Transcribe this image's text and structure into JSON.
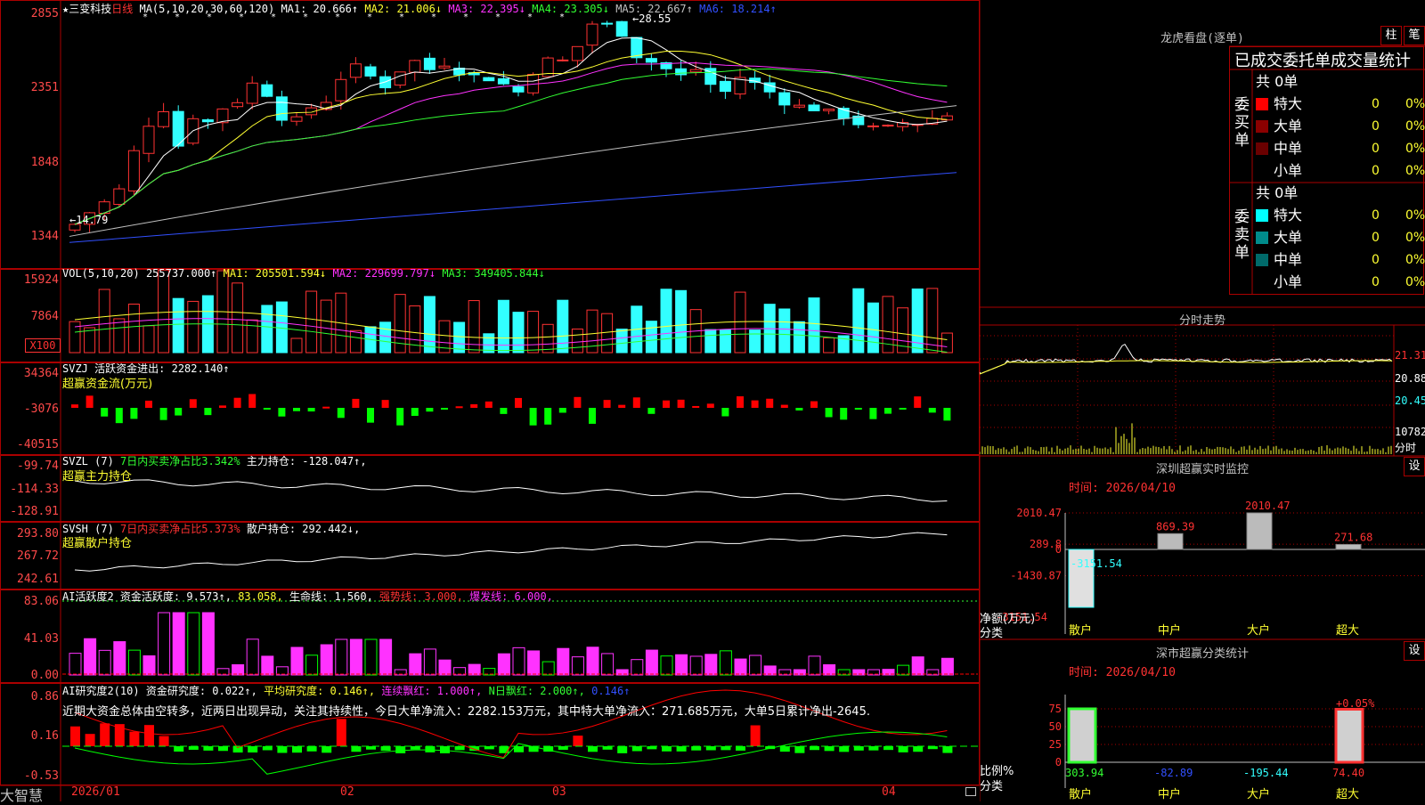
{
  "colors": {
    "up": "#ff3232",
    "down": "#32ffff",
    "ma1": "#ffffff",
    "ma2": "#ffff32",
    "ma3": "#ff32ff",
    "ma4": "#32ff32",
    "ma5": "#c0c0c0",
    "ma6": "#3250ff",
    "frame": "#aa0000"
  },
  "price_panel": {
    "stock_name": "★三变科技",
    "period": "日线",
    "ma_label": "MA(5,10,20,30,60,120)",
    "ma1": "MA1: 20.666↑",
    "ma2": "MA2: 21.006↓",
    "ma3": "MA3: 22.395↓",
    "ma4": "MA4: 23.305↓",
    "ma5": "MA5: 22.667↑",
    "ma6": "MA6: 18.214↑",
    "axis": [
      "2855",
      "2351",
      "1848",
      "1344"
    ],
    "high_label": "←28.55",
    "low_label": "←14.79"
  },
  "vol_panel": {
    "label": "VOL(5,10,20)",
    "value": "255737.000↑",
    "ma1": "MA1: 205501.594↓",
    "ma2": "MA2: 229699.797↓",
    "ma3": "MA3: 349405.844↓",
    "axis": [
      "15924",
      "7864"
    ],
    "unit": "X100"
  },
  "svzj_panel": {
    "label": "SVZJ",
    "title": "活跃资金进出: 2282.140↑",
    "subtitle": "超赢资金流(万元)",
    "axis": [
      "34364",
      "-3076",
      "-40515"
    ]
  },
  "svzl_panel": {
    "label": "SVZL (7)",
    "ratio": "7日内买卖净占比3.342%",
    "hold": "主力持仓: -128.047↑,",
    "subtitle": "超赢主力持仓",
    "axis": [
      "-99.74",
      "-114.33",
      "-128.91"
    ]
  },
  "svsh_panel": {
    "label": "SVSH (7)",
    "ratio": "7日内买卖净占比5.373%",
    "hold": "散户持仓: 292.442↓,",
    "subtitle": "超赢散户持仓",
    "axis": [
      "293.80",
      "267.72",
      "242.61"
    ]
  },
  "ai_active": {
    "label": "AI活跃度2",
    "activity": "资金活跃度: 9.573↑,",
    "v2": "83.058,",
    "life": "生命线: 1.560,",
    "strong": "强势线: 3.000,",
    "burst": "爆发线: 6.000,",
    "axis": [
      "83.06",
      "41.03",
      "0.00"
    ]
  },
  "ai_research": {
    "label": "AI研究度2(10)",
    "research": "资金研究度: 0.022↑,",
    "avg": "平均研究度: 0.146↑,",
    "cont": "连续飘红: 1.000↑,",
    "nday": "N日飘红: 2.000↑,",
    "last": "0.146↑",
    "commentary": "近期大资金总体由空转多，近两日出现异动，关注其持续性，今日大单净流入：2282.153万元，其中特大单净流入：271.685万元，大单5日累计净出-2645.",
    "axis": [
      "0.86",
      "0.16",
      "-0.53"
    ]
  },
  "bottom_bar": {
    "logo": "大智慧",
    "dates": [
      "2026/01",
      "02",
      "03",
      "04"
    ]
  },
  "dragon_panel": {
    "title": "龙虎看盘(逐单)",
    "btn_bar": "柱",
    "btn_pen": "笔",
    "header": "已成交委托单成交量统计",
    "buy_side": "委买单",
    "sell_side": "委卖单",
    "buy_total": "共 0单",
    "sell_total": "共 0单",
    "buy_rows": [
      {
        "label": "特大",
        "count": "0",
        "pct": "0%",
        "color": "#ff0000"
      },
      {
        "label": "大单",
        "count": "0",
        "pct": "0%",
        "color": "#8b0000"
      },
      {
        "label": "中单",
        "count": "0",
        "pct": "0%",
        "color": "#6a0000"
      },
      {
        "label": "小单",
        "count": "0",
        "pct": "0%",
        "color": "#000000"
      }
    ],
    "sell_rows": [
      {
        "label": "特大",
        "count": "0",
        "pct": "0%",
        "color": "#00ffff"
      },
      {
        "label": "大单",
        "count": "0",
        "pct": "0%",
        "color": "#008b8b"
      },
      {
        "label": "中单",
        "count": "0",
        "pct": "0%",
        "color": "#006a6a"
      },
      {
        "label": "小单",
        "count": "0",
        "pct": "0%",
        "color": "#000000"
      }
    ]
  },
  "intraday": {
    "title": "分时走势",
    "axis": [
      "21.31",
      "20.88",
      "20.45"
    ],
    "vol_label": "10782",
    "vol_sub": "分时"
  },
  "sz_monitor": {
    "title": "深圳超赢实时监控",
    "btn": "设",
    "time": "时间: 2026/04/10",
    "axis": [
      "2010.47",
      "289.8",
      "0",
      "-1430.87",
      "-3151.54"
    ],
    "ylabel": "净额(万元)",
    "xlabel": "分类",
    "categories": [
      "散户",
      "中户",
      "大户",
      "超大"
    ],
    "values": [
      -3151.54,
      869.39,
      2010.47,
      271.68
    ],
    "labels": [
      "-3151.54",
      "869.39",
      "2010.47",
      "271.68"
    ]
  },
  "sz_stats": {
    "title": "深市超赢分类统计",
    "btn": "设",
    "time": "时间: 2026/04/10",
    "axis": [
      "75",
      "50",
      "25",
      "0"
    ],
    "ylabel": "比例%",
    "xlabel": "分类",
    "categories": [
      "散户",
      "中户",
      "大户",
      "超大"
    ],
    "values": [
      303.94,
      -82.89,
      -195.44,
      74.4
    ],
    "labels": [
      "303.94",
      "-82.89",
      "-195.44",
      "74.40"
    ],
    "annot": "+0.05%"
  }
}
